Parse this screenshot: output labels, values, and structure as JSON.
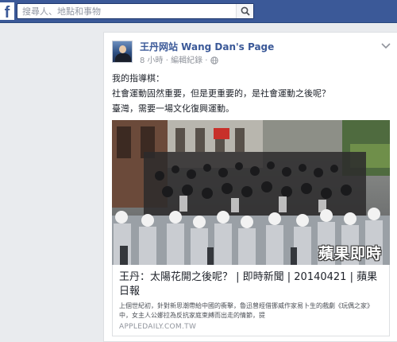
{
  "topbar": {
    "logo": "f",
    "search_placeholder": "搜尋人、地點和事物",
    "search_icon": "search-icon"
  },
  "post": {
    "page_name": "王丹网站 Wang Dan's Page",
    "time": "8 小時",
    "separator": " · ",
    "edit_history": "編輯紀錄",
    "privacy_icon": "globe-icon",
    "options_icon": "chevron-down-icon",
    "text_lines": [
      "我的指導棋：",
      "社會運動固然重要，但是更重要的，是社會運動之後呢？",
      "臺灣，需要一場文化復興運動。"
    ],
    "image": {
      "watermark": "蘋果即時"
    },
    "link": {
      "title": "王丹：太陽花開之後呢？ | 即時新聞 | 20140421 | 蘋果日報",
      "description": "上個世紀初，針對新思潮帶給中國的衝擊，魯迅曾經借挪威作家易卜生的戲劇《玩偶之家》中，女主人公娜拉為反抗家庭束縛而出走的情節，提",
      "domain": "APPLEDAILY.COM.TW"
    }
  },
  "colors": {
    "brand": "#3b5998",
    "link": "#3b5998",
    "muted": "#90949c"
  }
}
